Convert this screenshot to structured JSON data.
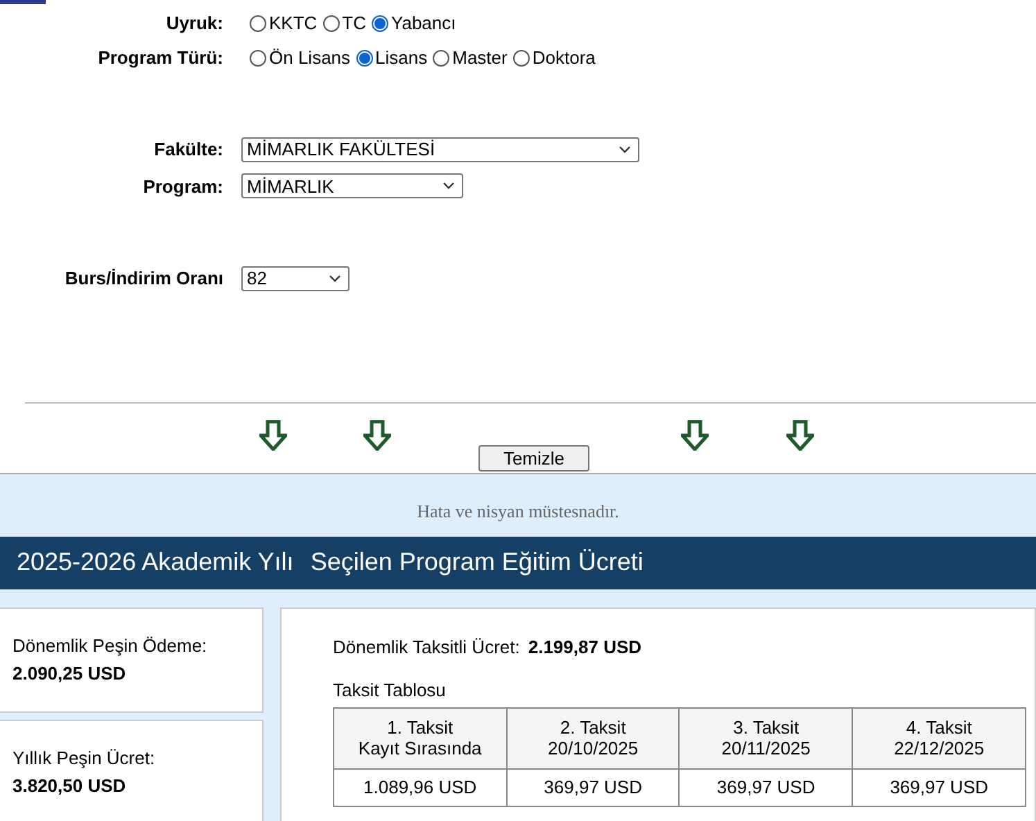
{
  "nationality": {
    "label": "Uyruk:",
    "options": [
      {
        "label": "KKTC",
        "selected": false
      },
      {
        "label": "TC",
        "selected": false
      },
      {
        "label": "Yabancı",
        "selected": true
      }
    ]
  },
  "program_type": {
    "label": "Program Türü:",
    "options": [
      {
        "label": "Ön Lisans",
        "selected": false
      },
      {
        "label": "Lisans",
        "selected": true
      },
      {
        "label": "Master",
        "selected": false
      },
      {
        "label": "Doktora",
        "selected": false
      }
    ]
  },
  "faculty": {
    "label": "Fakülte:",
    "value": "MİMARLIK FAKÜLTESİ"
  },
  "program": {
    "label": "Program:",
    "value": "MİMARLIK"
  },
  "discount": {
    "label": "Burs/İndirim Oranı",
    "value": "82"
  },
  "clear_button": "Temizle",
  "disclaimer": "Hata ve nisyan müstesnadır.",
  "header": {
    "year": "2025-2026 Akademik Yılı",
    "title": "Seçilen Program Eğitim Ücreti"
  },
  "side_cards": [
    {
      "label": "Dönemlik Peşin Ödeme:",
      "value": "2.090,25 USD"
    },
    {
      "label": "Yıllık Peşin Ücret:",
      "value": "3.820,50 USD"
    }
  ],
  "installment_fee": {
    "label": "Dönemlik Taksitli Ücret:",
    "value": "2.199,87 USD"
  },
  "table": {
    "caption": "Taksit Tablosu",
    "columns": [
      {
        "title": "1. Taksit",
        "subtitle": "Kayıt Sırasında"
      },
      {
        "title": "2. Taksit",
        "subtitle": "20/10/2025"
      },
      {
        "title": "3. Taksit",
        "subtitle": "20/11/2025"
      },
      {
        "title": "4. Taksit",
        "subtitle": "22/12/2025"
      }
    ],
    "rows": [
      [
        "1.089,96 USD",
        "369,97 USD",
        "369,97 USD",
        "369,97 USD"
      ]
    ]
  }
}
